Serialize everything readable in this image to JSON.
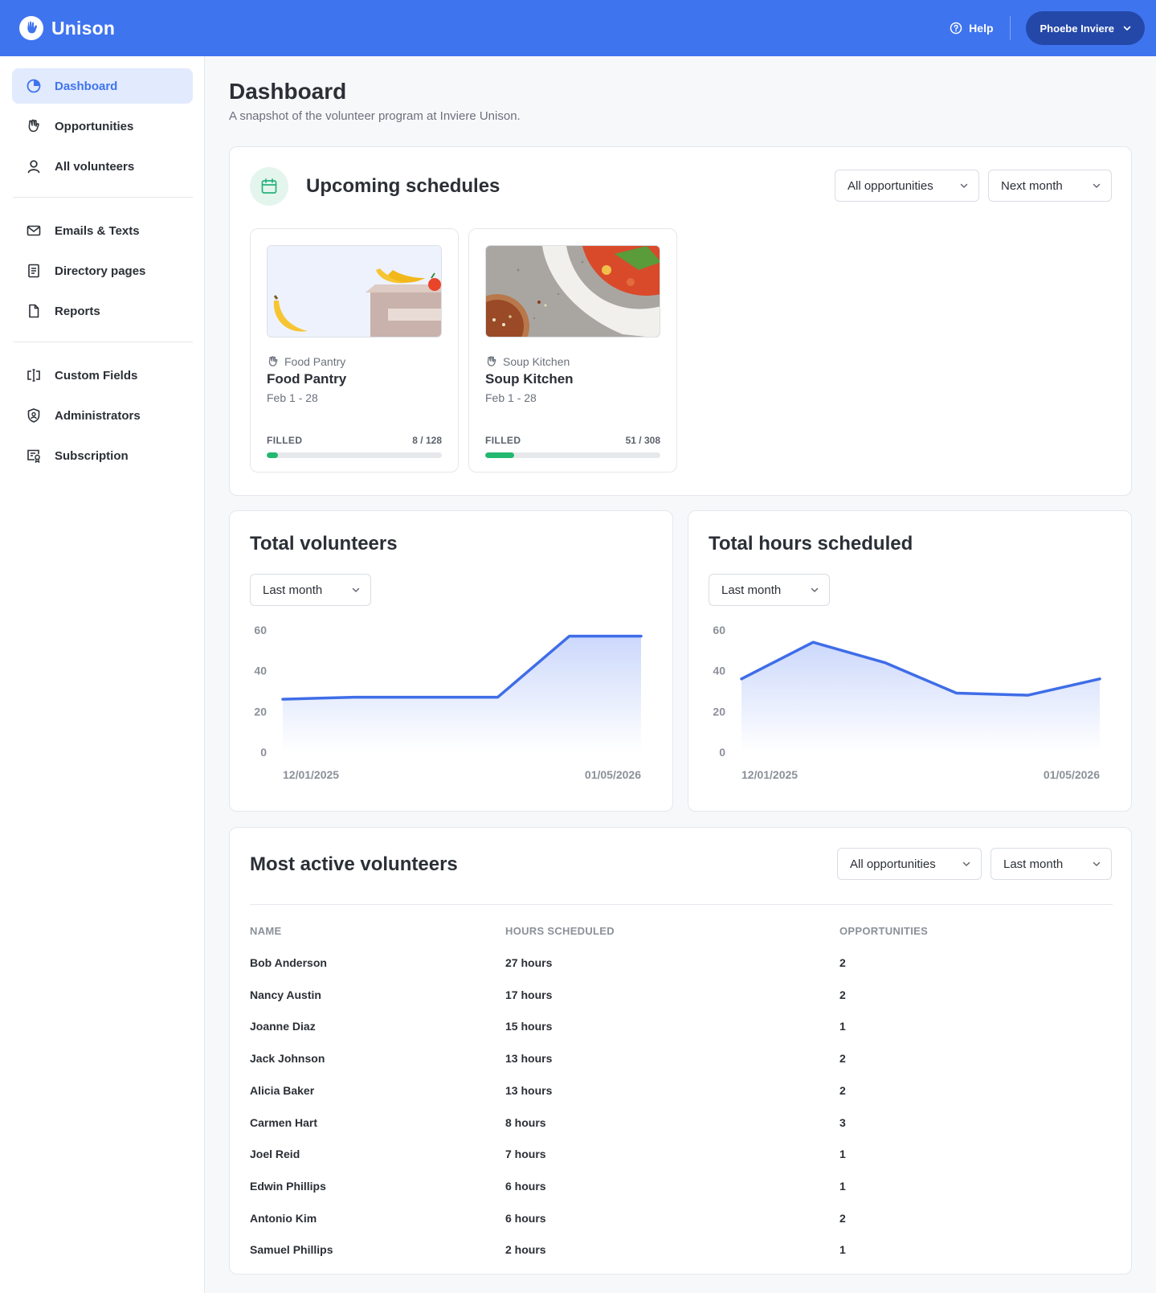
{
  "app": {
    "name": "Unison",
    "accent": "#3f74ef"
  },
  "topbar": {
    "help_label": "Help",
    "user_label": "Phoebe Inviere"
  },
  "sidebar": {
    "items": [
      {
        "label": "Dashboard",
        "icon": "pie-chart-icon",
        "active": true
      },
      {
        "label": "Opportunities",
        "icon": "hand-heart-icon"
      },
      {
        "label": "All volunteers",
        "icon": "user-icon"
      },
      {
        "label": "Emails & Texts",
        "icon": "mail-icon"
      },
      {
        "label": "Directory pages",
        "icon": "document-list-icon"
      },
      {
        "label": "Reports",
        "icon": "file-icon"
      },
      {
        "label": "Custom Fields",
        "icon": "text-cursor-icon"
      },
      {
        "label": "Administrators",
        "icon": "shield-user-icon"
      },
      {
        "label": "Subscription",
        "icon": "certificate-icon"
      }
    ]
  },
  "page": {
    "title": "Dashboard",
    "subtitle": "A snapshot of the volunteer program at Inviere Unison."
  },
  "upcoming": {
    "title": "Upcoming schedules",
    "filter_opportunity": "All opportunities",
    "filter_period": "Next month",
    "cards": [
      {
        "category": "Food Pantry",
        "name": "Food Pantry",
        "dates": "Feb 1 - 28",
        "filled_label": "FILLED",
        "filled_text": "8 / 128",
        "filled_fraction": 0.0625
      },
      {
        "category": "Soup Kitchen",
        "name": "Soup Kitchen",
        "dates": "Feb 1 - 28",
        "filled_label": "FILLED",
        "filled_text": "51 / 308",
        "filled_fraction": 0.1656
      }
    ]
  },
  "total_volunteers": {
    "title": "Total volunteers",
    "filter_period": "Last month"
  },
  "total_hours": {
    "title": "Total hours scheduled",
    "filter_period": "Last month"
  },
  "chart_data": [
    {
      "type": "area",
      "y_ticks": [
        0,
        20,
        40,
        60
      ],
      "ylim": [
        0,
        60
      ],
      "x_tick_labels": [
        "12/01/2025",
        "01/05/2026"
      ],
      "series": [
        {
          "values": [
            26,
            27,
            27,
            27,
            57,
            57
          ]
        }
      ],
      "color": "#3f6de8",
      "grid": false
    },
    {
      "type": "area",
      "y_ticks": [
        0,
        20,
        40,
        60
      ],
      "ylim": [
        0,
        60
      ],
      "x_tick_labels": [
        "12/01/2025",
        "01/05/2026"
      ],
      "series": [
        {
          "values": [
            36,
            54,
            44,
            29,
            28,
            36
          ]
        }
      ],
      "color": "#3f6de8",
      "grid": false
    }
  ],
  "most_active": {
    "title": "Most active volunteers",
    "filter_opportunity": "All opportunities",
    "filter_period": "Last month",
    "columns": [
      "NAME",
      "HOURS SCHEDULED",
      "OPPORTUNITIES"
    ],
    "rows": [
      [
        "Bob Anderson",
        "27 hours",
        "2"
      ],
      [
        "Nancy Austin",
        "17 hours",
        "2"
      ],
      [
        "Joanne Diaz",
        "15 hours",
        "1"
      ],
      [
        "Jack Johnson",
        "13 hours",
        "2"
      ],
      [
        "Alicia Baker",
        "13 hours",
        "2"
      ],
      [
        "Carmen Hart",
        "8 hours",
        "3"
      ],
      [
        "Joel Reid",
        "7 hours",
        "1"
      ],
      [
        "Edwin Phillips",
        "6 hours",
        "1"
      ],
      [
        "Antonio Kim",
        "6 hours",
        "2"
      ],
      [
        "Samuel Phillips",
        "2 hours",
        "1"
      ]
    ]
  }
}
